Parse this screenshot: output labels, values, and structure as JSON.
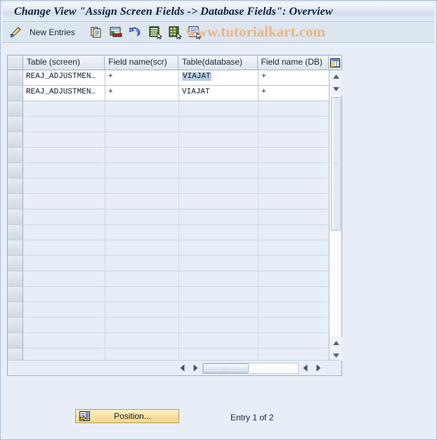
{
  "window": {
    "title": "Change View \"Assign Screen Fields -> Database Fields\": Overview"
  },
  "toolbar": {
    "display_change_icon": "pencil-display-change-icon",
    "new_entries_label": "New Entries",
    "items": [
      {
        "icon": "copy-icon",
        "name": "copy-as-button"
      },
      {
        "icon": "delete-icon",
        "name": "delete-button"
      },
      {
        "icon": "undo-icon",
        "name": "undo-button"
      },
      {
        "icon": "select-all-icon",
        "name": "select-all-button"
      },
      {
        "icon": "deselect-all-icon",
        "name": "deselect-all-button"
      },
      {
        "icon": "details-icon",
        "name": "details-button"
      }
    ],
    "watermark": "www.tutorialkart.com"
  },
  "table": {
    "config_icon": "column-config-icon",
    "columns": [
      "Table (screen)",
      "Field name(scr)",
      "Table(database)",
      "Field name (DB)"
    ],
    "rows": [
      {
        "table_screen": "REAJ_ADJUSTMEN…",
        "field_scr": "+",
        "table_db": "VIAJAT",
        "field_db": "+",
        "selected_cell": "table_db"
      },
      {
        "table_screen": "REAJ_ADJUSTMEN…",
        "field_scr": "+",
        "table_db": "VIAJAT",
        "field_db": "+",
        "selected_cell": ""
      }
    ],
    "empty_row_count": 17,
    "scroll_up_icon": "scroll-up-icon",
    "scroll_down_icon": "scroll-down-icon",
    "hscroll_left_icon": "scroll-left-icon",
    "hscroll_right_icon": "scroll-right-icon"
  },
  "footer": {
    "position_button_label": "Position...",
    "position_button_icon": "position-icon",
    "entry_status": "Entry 1 of 2"
  },
  "colors": {
    "page_background": "#e8eef7",
    "title_text": "#12263d",
    "watermark": "#e8b684",
    "grid_border": "#96b0cb",
    "selection_highlight": "#b8cee4",
    "button_yellow": "#f8e0a0"
  }
}
